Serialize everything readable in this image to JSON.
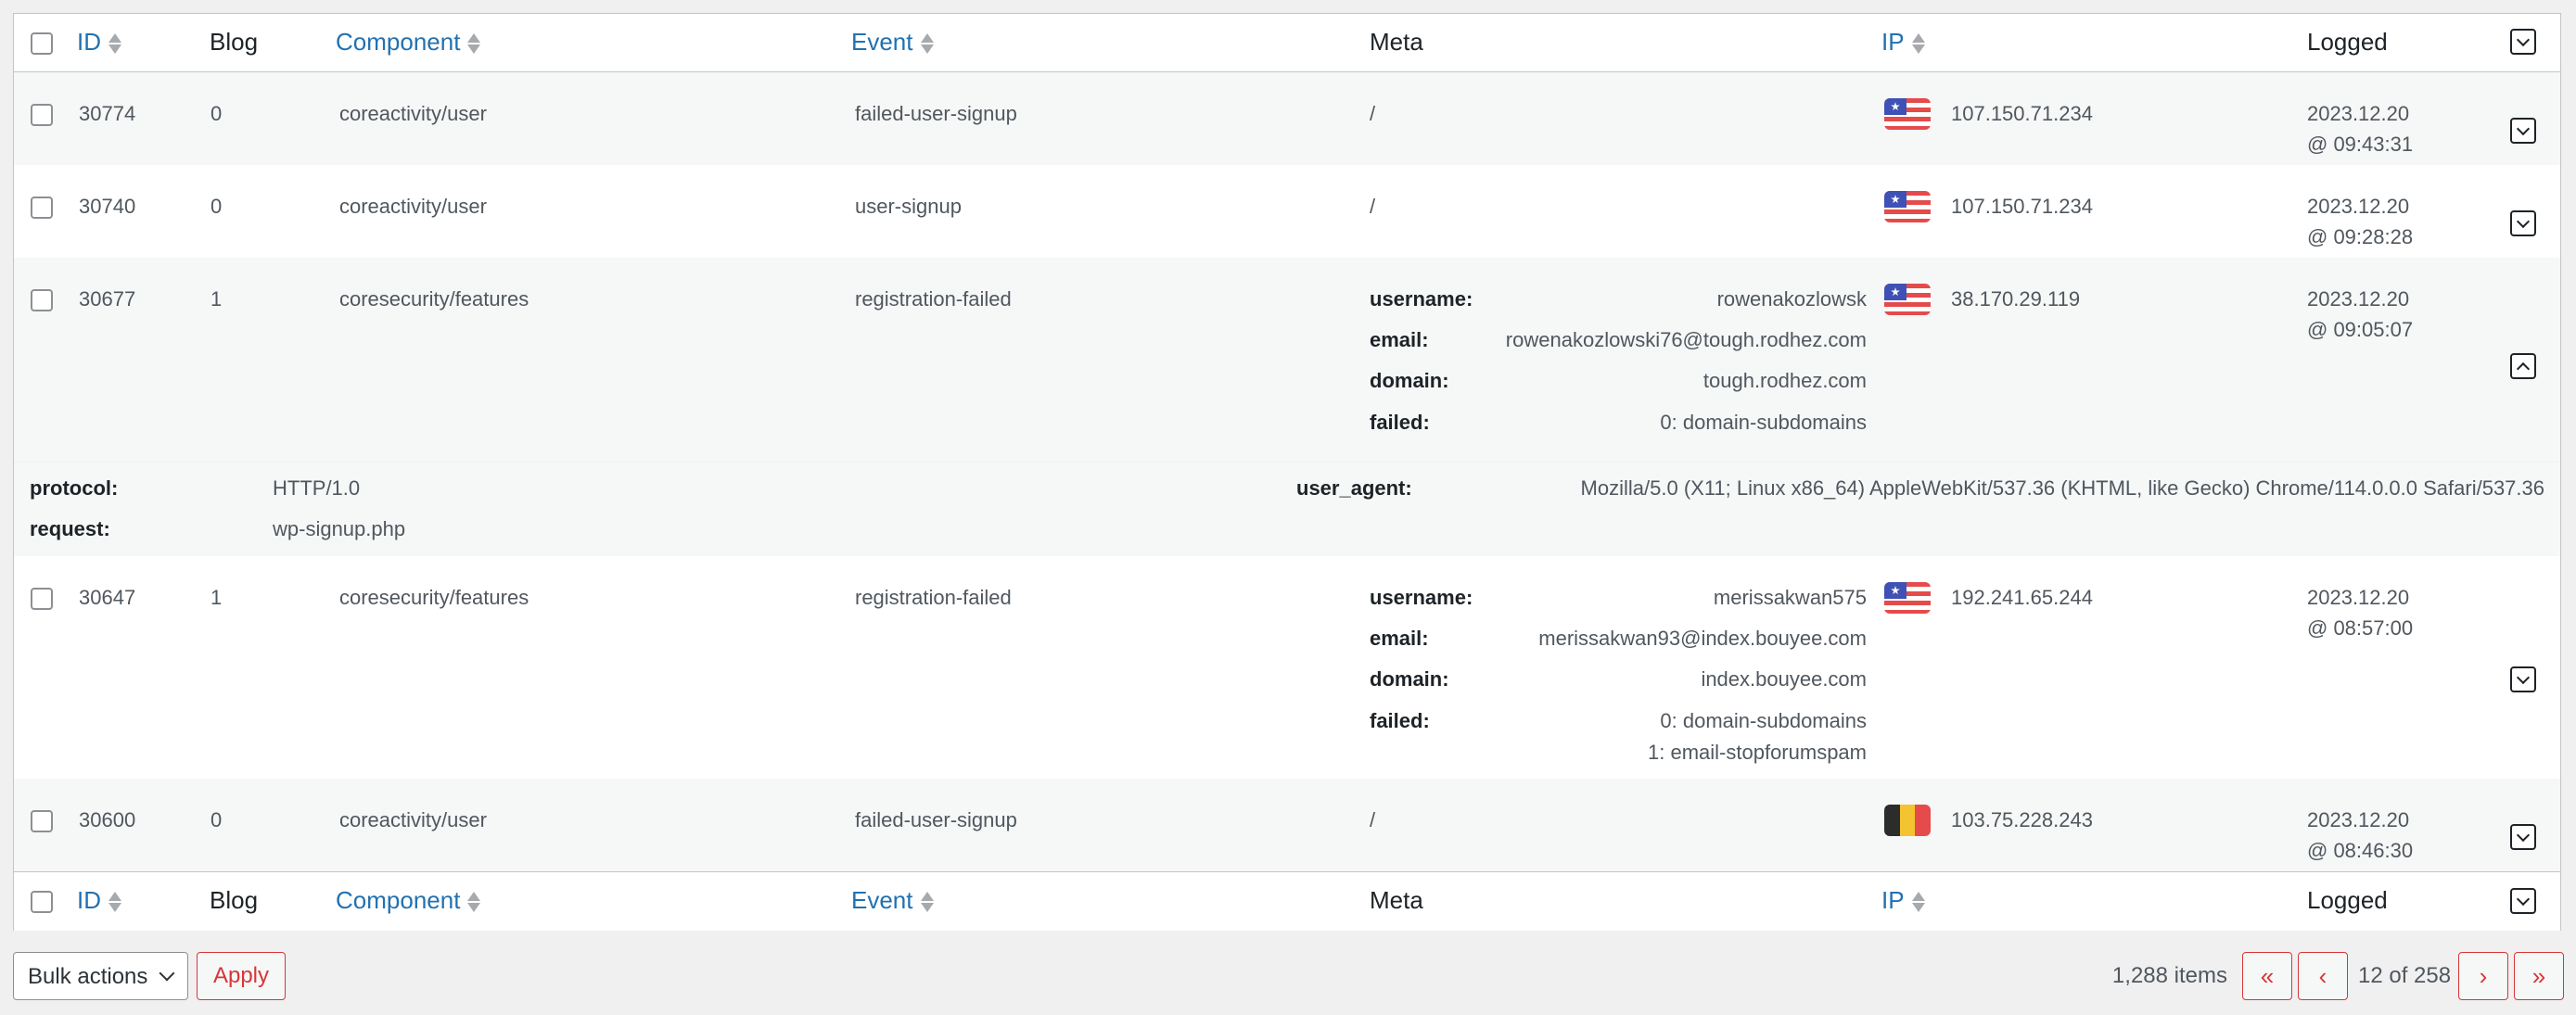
{
  "columns": {
    "id": "ID",
    "blog": "Blog",
    "component": "Component",
    "event": "Event",
    "meta": "Meta",
    "ip": "IP",
    "logged": "Logged"
  },
  "rows": [
    {
      "id": "30774",
      "blog": "0",
      "component": "coreactivity/user",
      "event": "failed-user-signup",
      "meta_text": "/",
      "flag": "us-flag-icon",
      "ip": "107.150.71.234",
      "date": "2023.12.20",
      "time": "@ 09:43:31"
    },
    {
      "id": "30740",
      "blog": "0",
      "component": "coreactivity/user",
      "event": "user-signup",
      "meta_text": "/",
      "flag": "us-flag-icon",
      "ip": "107.150.71.234",
      "date": "2023.12.20",
      "time": "@ 09:28:28"
    },
    {
      "id": "30677",
      "blog": "1",
      "component": "coresecurity/features",
      "event": "registration-failed",
      "meta": {
        "username_label": "username:",
        "username": "rowenakozlowsk",
        "email_label": "email:",
        "email": "rowenakozlowski76@tough.rodhez.com",
        "domain_label": "domain:",
        "domain": "tough.rodhez.com",
        "failed_label": "failed:",
        "failed": [
          "0: domain-subdomains"
        ]
      },
      "flag": "us-flag-icon",
      "ip": "38.170.29.119",
      "date": "2023.12.20",
      "time": "@ 09:05:07",
      "expanded": {
        "protocol_label": "protocol:",
        "protocol": "HTTP/1.0",
        "request_label": "request:",
        "request": "wp-signup.php",
        "user_agent_label": "user_agent:",
        "user_agent": "Mozilla/5.0 (X11; Linux x86_64) AppleWebKit/537.36 (KHTML, like Gecko) Chrome/114.0.0.0 Safari/537.36"
      }
    },
    {
      "id": "30647",
      "blog": "1",
      "component": "coresecurity/features",
      "event": "registration-failed",
      "meta": {
        "username_label": "username:",
        "username": "merissakwan575",
        "email_label": "email:",
        "email": "merissakwan93@index.bouyee.com",
        "domain_label": "domain:",
        "domain": "index.bouyee.com",
        "failed_label": "failed:",
        "failed": [
          "0: domain-subdomains",
          "1: email-stopforumspam"
        ]
      },
      "flag": "us-flag-icon",
      "ip": "192.241.65.244",
      "date": "2023.12.20",
      "time": "@ 08:57:00"
    },
    {
      "id": "30600",
      "blog": "0",
      "component": "coreactivity/user",
      "event": "failed-user-signup",
      "meta_text": "/",
      "flag": "belgium-flag-icon",
      "ip": "103.75.228.243",
      "date": "2023.12.20",
      "time": "@ 08:46:30"
    }
  ],
  "bulk": {
    "selected": "Bulk actions",
    "apply": "Apply"
  },
  "pagination": {
    "items": "1,288 items",
    "first": "«",
    "prev": "‹",
    "current": "12 of 258",
    "next": "›",
    "last": "»"
  },
  "colors": {
    "link": "#2271b1",
    "danger": "#d63638",
    "us_red": "#e54b4b",
    "us_blue": "#3f51b5",
    "be_black": "#2c2c2c",
    "be_yellow": "#f4c430",
    "be_red": "#e54b4b"
  }
}
